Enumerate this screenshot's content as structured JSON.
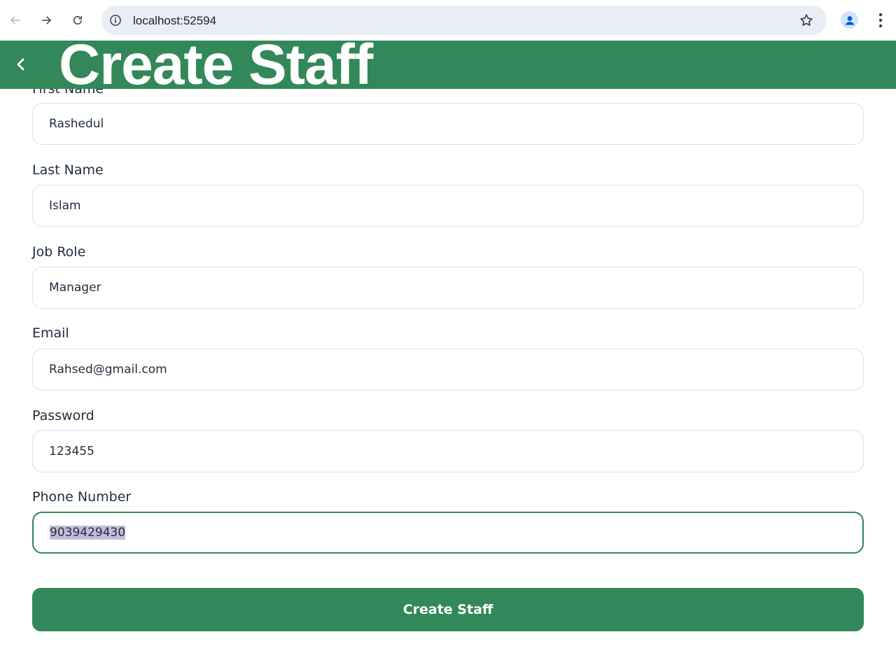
{
  "browser": {
    "url": "localhost:52594"
  },
  "header": {
    "title": "Create Staff",
    "bg_color": "#328858"
  },
  "form": {
    "fields": [
      {
        "label": "First Name",
        "value": "Rashedul"
      },
      {
        "label": "Last Name",
        "value": "Islam"
      },
      {
        "label": "Job Role",
        "value": "Manager"
      },
      {
        "label": "Email",
        "value": "Rahsed@gmail.com"
      },
      {
        "label": "Password",
        "value": "123455"
      },
      {
        "label": "Phone Number",
        "value": "9039429430"
      }
    ],
    "submit_label": "Create Staff"
  },
  "colors": {
    "accent": "#328858",
    "input_border": "#d9dcf5",
    "selection": "#c3bddc"
  }
}
